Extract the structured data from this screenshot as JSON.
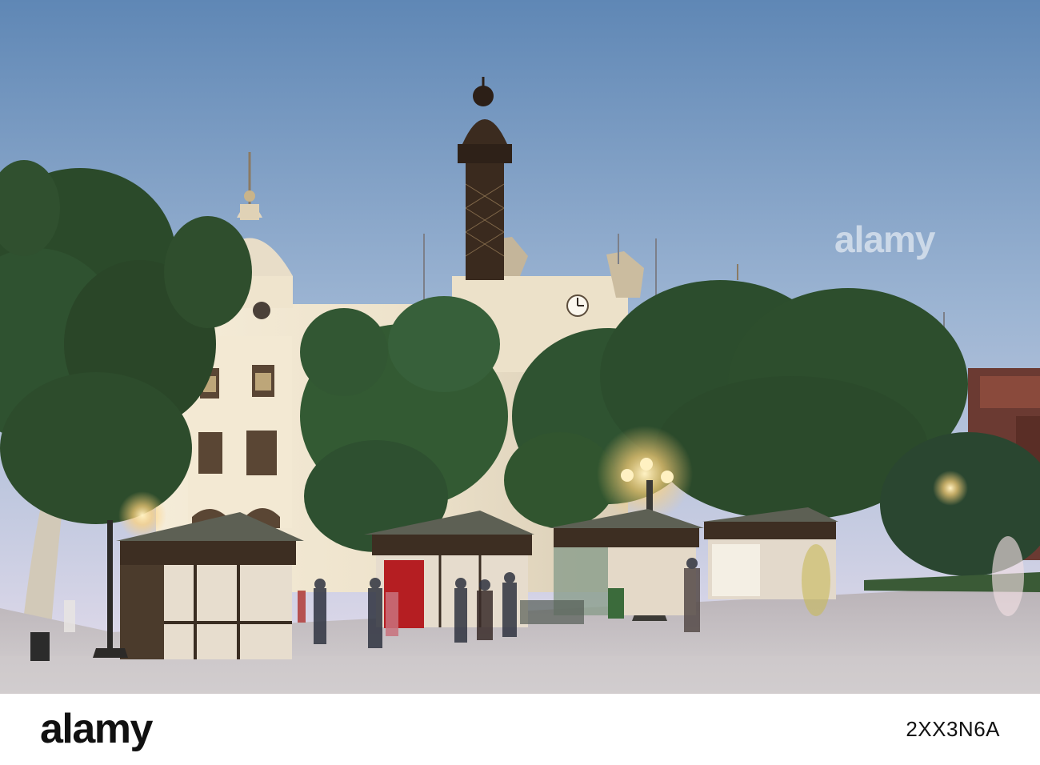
{
  "watermark": {
    "logo": "alamy",
    "text_color": "#ffffff"
  },
  "footer": {
    "logo": "alamy",
    "image_id": "2XX3N6A",
    "background": "#ffffff",
    "text_color": "#111111"
  },
  "scene": {
    "sky_top": "#5f87b5",
    "sky_bottom": "#e6ddec",
    "facade": "#efe6d2",
    "tree": "#2c4a2b",
    "lamp_glow": "#ffd27a",
    "pavement": "#c9c5c8",
    "kiosk_roof": "#5a5d52",
    "kiosk_panel": "#e6dccd",
    "kiosk_frame": "#3a2d22",
    "awning_red": "#b51e22"
  }
}
